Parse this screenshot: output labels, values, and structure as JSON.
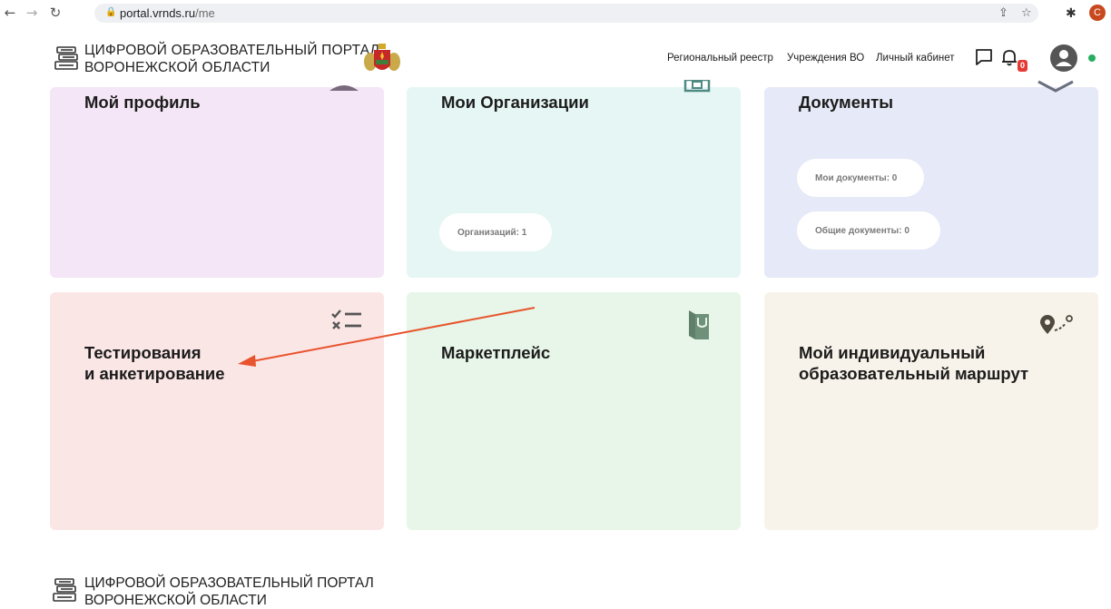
{
  "browser": {
    "url_host": "portal.vrnds.ru",
    "url_path": "/me",
    "profile_initial": "C"
  },
  "header": {
    "logo_line1": "ЦИФРОВОЙ ОБРАЗОВАТЕЛЬНЫЙ ПОРТАЛ",
    "logo_line2": "ВОРОНЕЖСКОЙ ОБЛАСТИ",
    "nav": [
      "Региональный реестр",
      "Учреждения ВО",
      "Личный кабинет"
    ],
    "notifications_count": "0"
  },
  "cards": {
    "profile": {
      "title": "Мой профиль"
    },
    "orgs": {
      "title": "Мои Организации",
      "pill": "Организаций: 1"
    },
    "docs": {
      "title": "Документы",
      "pill_my": "Мои документы: 0",
      "pill_common": "Общие документы: 0"
    },
    "tests": {
      "title_line1": "Тестирования",
      "title_line2": "и анкетирование"
    },
    "market": {
      "title": "Маркетплейс"
    },
    "route": {
      "title_line1": "Мой индивидуальный",
      "title_line2": "образовательный маршрут"
    }
  },
  "footer": {
    "logo_line1": "ЦИФРОВОЙ ОБРАЗОВАТЕЛЬНЫЙ ПОРТАЛ",
    "logo_line2": "ВОРОНЕЖСКОЙ ОБЛАСТИ"
  },
  "colors": {
    "card_profile": "#f4e6f6",
    "card_orgs": "#e5f6f4",
    "card_docs": "#e6e9f7",
    "card_tests": "#fbe6e6",
    "card_market": "#e7f6e8",
    "card_route": "#f8f3ea",
    "annotation_arrow": "#e8542e",
    "badge": "#e53935"
  }
}
